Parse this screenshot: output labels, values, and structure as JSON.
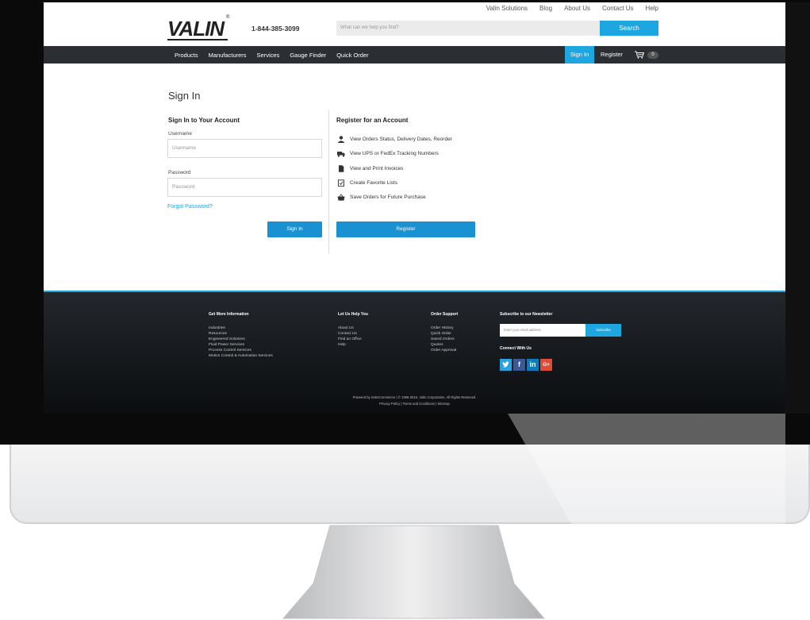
{
  "top_links": [
    "Valin Solutions",
    "Blog",
    "About Us",
    "Contact Us",
    "Help"
  ],
  "logo": "VALIN",
  "phone": "1-844-385-3099",
  "search": {
    "placeholder": "What can we help you find?",
    "button": "Search"
  },
  "nav": {
    "items": [
      "Products",
      "Manufacturers",
      "Services",
      "Gauge Finder",
      "Quick Order"
    ],
    "sign_in": "Sign In",
    "register": "Register",
    "cart_count": "0"
  },
  "page": {
    "title": "Sign In",
    "signin": {
      "heading": "Sign In to Your Account",
      "username_label": "Username",
      "username_placeholder": "Username",
      "password_label": "Password",
      "password_placeholder": "Password",
      "forgot": "Forgot Password?",
      "button": "Sign In"
    },
    "register": {
      "heading": "Register for an Account",
      "benefits": [
        {
          "icon": "user-icon",
          "text": "View Orders Status, Delivery Dates, Reorder"
        },
        {
          "icon": "truck-icon",
          "text": "View UPS or FedEx Tracking Numbers"
        },
        {
          "icon": "document-icon",
          "text": "View and Print Invoices"
        },
        {
          "icon": "checklist-icon",
          "text": "Create Favorite Lists"
        },
        {
          "icon": "basket-icon",
          "text": "Save Orders for Future Purchase"
        }
      ],
      "button": "Register"
    }
  },
  "footer": {
    "col1": {
      "heading": "Get More Information",
      "items": [
        "Industries",
        "Resources",
        "Engineered Solutions",
        "Fluid Power Services",
        "Process Control Services",
        "Motion Control & Automation Services"
      ]
    },
    "col2": {
      "heading": "Let Us Help You",
      "items": [
        "About Us",
        "Contact Us",
        "Find an Office",
        "Help"
      ]
    },
    "col3": {
      "heading": "Order Support",
      "items": [
        "Order History",
        "Quick Order",
        "Saved Orders",
        "Quotes",
        "Order Approval"
      ]
    },
    "newsletter": {
      "heading": "Subscribe to our Newsletter",
      "placeholder": "Enter your email address",
      "button": "Subscribe"
    },
    "connect": {
      "heading": "Connect With Us"
    },
    "social": [
      {
        "icon": "twitter-icon",
        "color": "#2aa3dc"
      },
      {
        "icon": "facebook-icon",
        "color": "#3b5998"
      },
      {
        "icon": "linkedin-icon",
        "color": "#0f7ab8"
      },
      {
        "icon": "googleplus-icon",
        "color": "#dd4b39"
      }
    ],
    "copyright": "Powered by InsiteCommerce | © 1996-2015, Valin Corporation, All Rights Reserved.",
    "links": "Privacy Policy | Terms and Conditions | Sitemap"
  },
  "colors": {
    "accent": "#1ea6e0",
    "nav_bg": "#2b2e32",
    "button": "#1a91d1"
  }
}
